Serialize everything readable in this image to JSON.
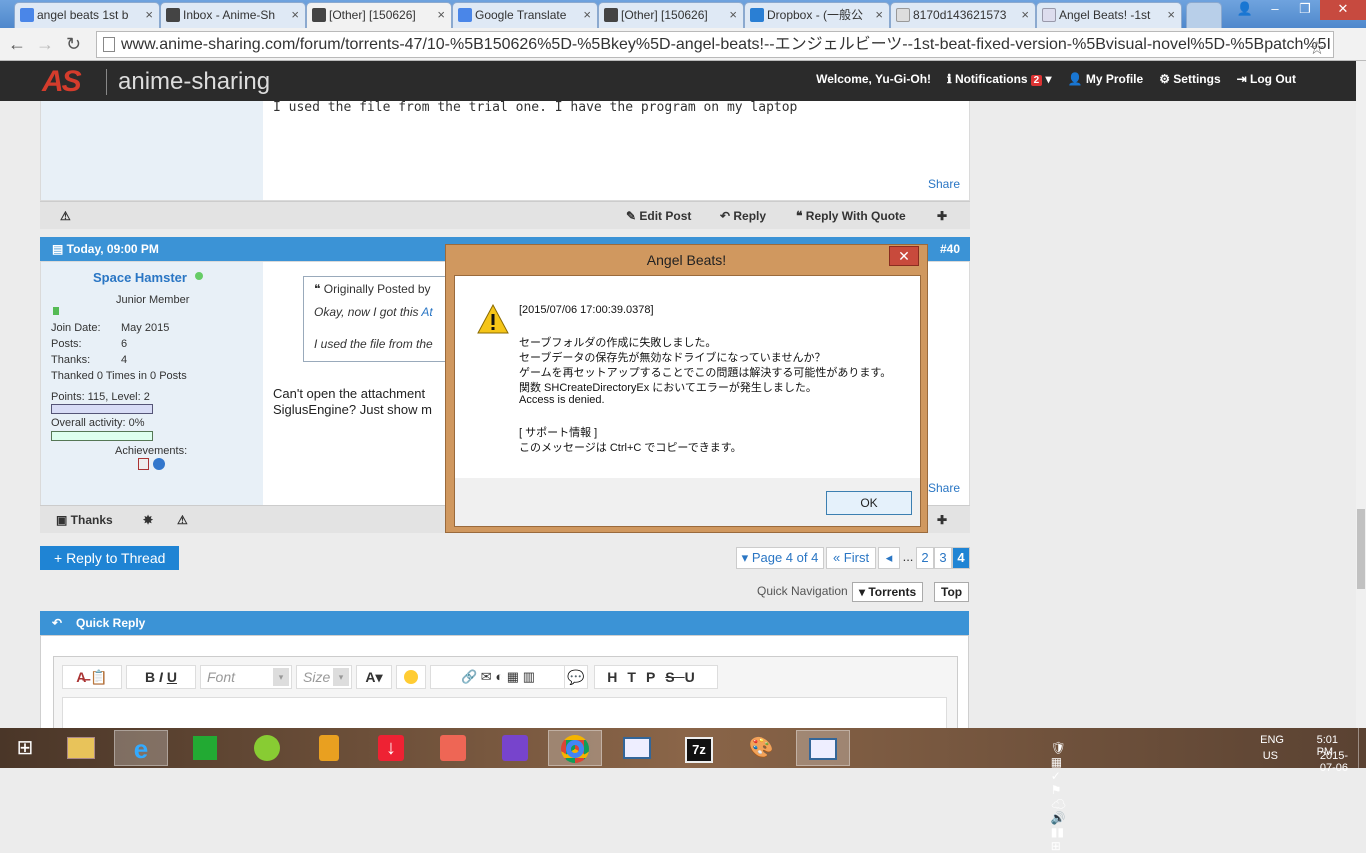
{
  "tabs": [
    {
      "label": "angel beats 1st b",
      "color": "#4a86e8"
    },
    {
      "label": "Inbox - Anime-Sh",
      "color": "#444"
    },
    {
      "label": "[Other] [150626]",
      "color": "#444"
    },
    {
      "label": "Google Translate",
      "color": "#4a86e8"
    },
    {
      "label": "[Other] [150626]",
      "color": "#444"
    },
    {
      "label": "Dropbox - (一般公",
      "color": "#2a7fd4"
    },
    {
      "label": "8170d143621573",
      "color": "#aaa"
    },
    {
      "label": "Angel Beats! -1st",
      "color": "#cce"
    }
  ],
  "address": {
    "url": "www.anime-sharing.com/forum/torrents-47/10-%5B150626%5D-%5Bkey%5D-angel-beats!--エンジェルビーツ--1st-beat-fixed-version-%5Bvisual-novel%5D-%5Bpatch%5I"
  },
  "site": {
    "logo_as": "AS",
    "logo_name": "anime-sharing"
  },
  "usernav": {
    "welcome": "Welcome,",
    "username": "Yu-Gi-Oh!",
    "notifications": "Notifications",
    "notif_count": "2",
    "profile": "My Profile",
    "settings": "Settings",
    "logout": "Log Out"
  },
  "prev_post": {
    "text": "I used the file from the trial one. I have the program on my laptop",
    "share": "Share",
    "edit": "Edit Post",
    "reply": "Reply",
    "quote": "Reply With Quote"
  },
  "post": {
    "date": "Today, 09:00 PM",
    "number": "#40",
    "username": "Space Hamster",
    "rank": "Junior Member",
    "join_label": "Join Date:",
    "join_value": "May 2015",
    "posts_label": "Posts:",
    "posts_value": "6",
    "thanks_label": "Thanks:",
    "thanks_value": "4",
    "thanked": "Thanked 0 Times in 0 Posts",
    "points": "Points: 115, Level: 2",
    "activity": "Overall activity: 0%",
    "achievements": "Achievements:",
    "quote_by": "Originally Posted by",
    "quote_line1_a": "Okay, now I got this",
    "quote_line1_b": "At",
    "quote_line2": "I used the file from the",
    "body_line1": "Can't open the attachment",
    "body_line2": "SiglusEngine? Just show m",
    "share": "Share",
    "thanks_btn": "Thanks",
    "points_fill": 0.0,
    "activity_fill": 0.0
  },
  "thread_nav": {
    "reply_btn": "+ Reply to Thread",
    "page_of": "Page 4 of 4",
    "first": "First",
    "prev": "◂",
    "ellipsis": "...",
    "p2": "2",
    "p3": "3",
    "p4": "4",
    "quick_nav": "Quick Navigation",
    "torrents": "Torrents",
    "top": "Top"
  },
  "quick_reply": {
    "title": "Quick Reply",
    "font": "Font",
    "size": "Size"
  },
  "dialog": {
    "title": "Angel Beats!",
    "timestamp": "[2015/07/06 17:00:39.0378]",
    "line1": "セーブフォルダの作成に失敗しました。",
    "line2": "セーブデータの保存先が無効なドライブになっていませんか？",
    "line3": "ゲームを再セットアップすることでこの問題は解決する可能性があります。",
    "line4": "関数 SHCreateDirectoryEx においてエラーが発生しました。",
    "line5": "Access is denied.",
    "support": "[ サポート情報 ]",
    "copy_hint": "このメッセージは Ctrl+C でコピーできます。",
    "ok": "OK"
  },
  "tray": {
    "lang1": "ENG",
    "lang2": "US",
    "time": "5:01 PM",
    "date": "2015-07-06"
  }
}
